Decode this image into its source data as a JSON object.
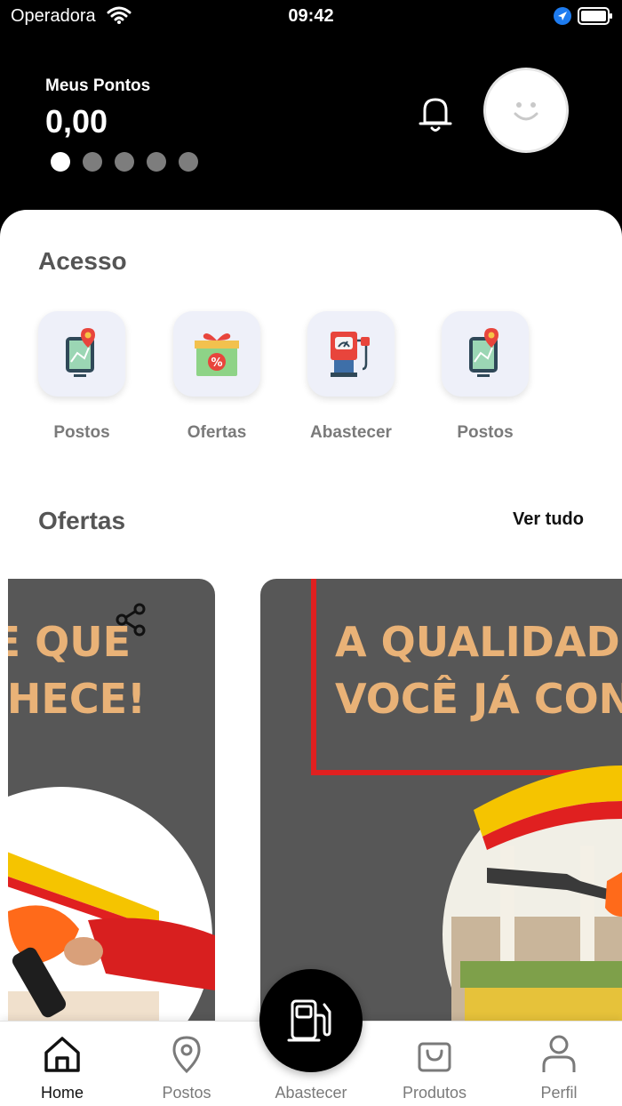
{
  "status_bar": {
    "carrier": "Operadora",
    "time": "09:42"
  },
  "header": {
    "points_label": "Meus Pontos",
    "points_value": "0,00",
    "carousel_dots": 5,
    "active_dot": 1
  },
  "acesso": {
    "title": "Acesso",
    "items": [
      {
        "label": "Postos",
        "icon": "map-pin-tablet-icon"
      },
      {
        "label": "Ofertas",
        "icon": "gift-percent-icon"
      },
      {
        "label": "Abastecer",
        "icon": "fuel-pump-icon"
      },
      {
        "label": "Postos",
        "icon": "map-pin-tablet-icon"
      }
    ]
  },
  "ofertas": {
    "title": "Ofertas",
    "see_all": "Ver tudo",
    "banners": [
      {
        "line1": "E QUE",
        "line2": "HECE!"
      },
      {
        "line1": "A QUALIDADE",
        "line2": "VOCÊ JÁ CON"
      }
    ]
  },
  "bottom_nav": {
    "items": [
      {
        "label": "Home",
        "icon": "home-icon",
        "active": true
      },
      {
        "label": "Postos",
        "icon": "map-pin-icon",
        "active": false
      },
      {
        "label": "Abastecer",
        "icon": "fuel-pump-icon",
        "active": false
      },
      {
        "label": "Produtos",
        "icon": "shopping-bag-icon",
        "active": false
      },
      {
        "label": "Perfil",
        "icon": "user-icon",
        "active": false
      }
    ]
  },
  "colors": {
    "accent_text": "#e9b277",
    "banner_bg": "#575757",
    "brand_red": "#e02020",
    "brand_yellow": "#f5c400"
  }
}
